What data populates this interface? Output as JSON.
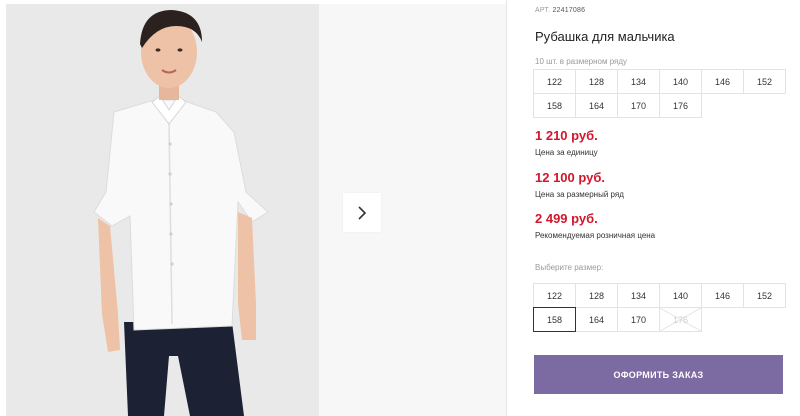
{
  "product": {
    "article_label": "АРТ.",
    "article": "22417086",
    "title": "Рубашка для мальчика",
    "sizes_note": "10 шт. в размерном ряду"
  },
  "size_row": [
    "122",
    "128",
    "134",
    "140",
    "146",
    "152",
    "158",
    "164",
    "170",
    "176"
  ],
  "prices": [
    {
      "value": "1 210 руб.",
      "label": "Цена за единицу"
    },
    {
      "value": "12 100 руб.",
      "label": "Цена за размерный ряд"
    },
    {
      "value": "2 499 руб.",
      "label": "Рекомендуемая розничная цена"
    }
  ],
  "size_picker": {
    "label": "Выберите размер:",
    "options": [
      "122",
      "128",
      "134",
      "140",
      "146",
      "152",
      "158",
      "164",
      "170",
      "176"
    ],
    "selected": "158",
    "unavailable": [
      "176"
    ]
  },
  "order_button": "ОФОРМИТЬ ЗАКАЗ",
  "colors": {
    "price": "#d2162b",
    "button": "#7c6aa3"
  },
  "icons": {
    "next": "chevron-right-icon"
  }
}
